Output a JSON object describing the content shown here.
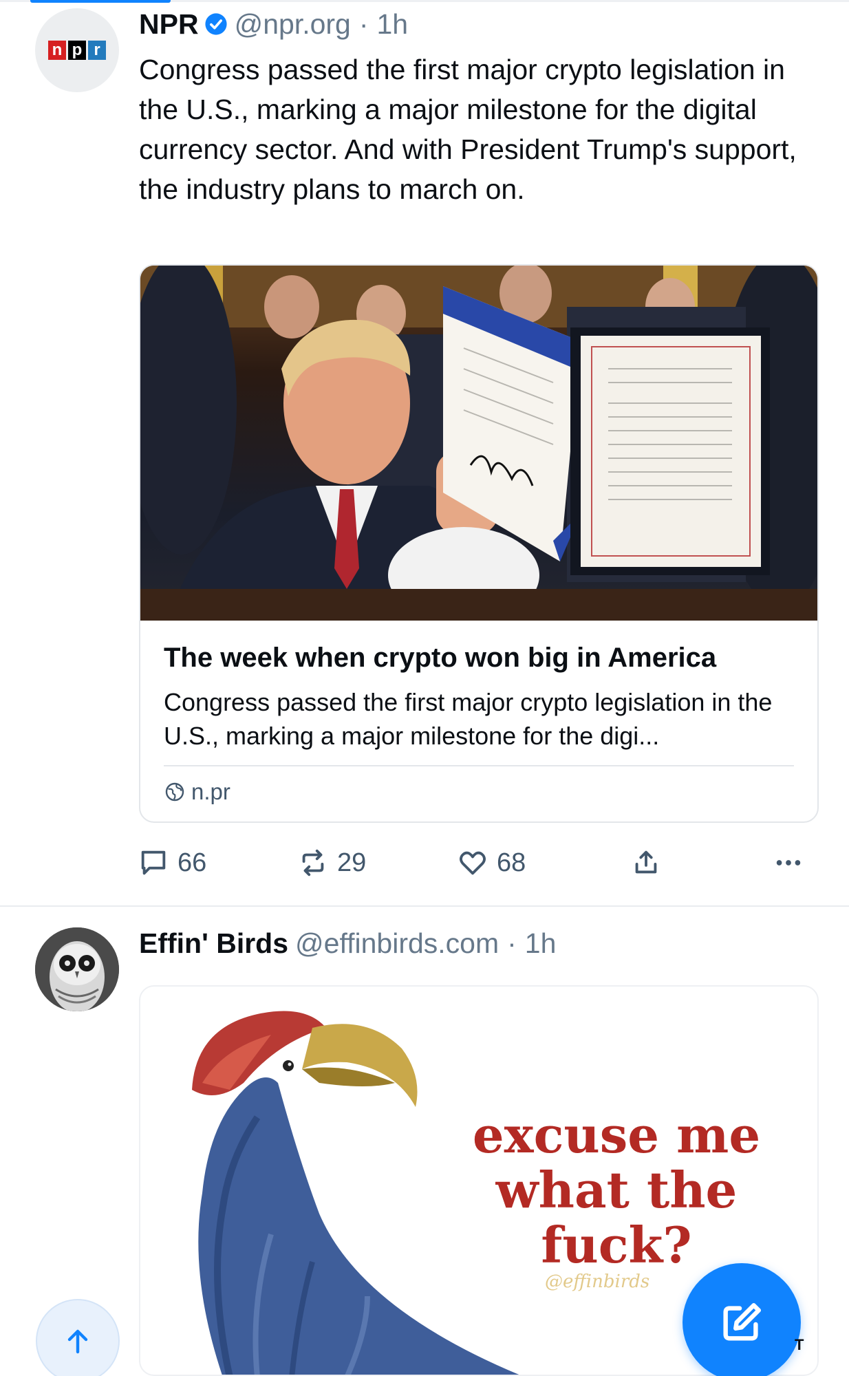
{
  "feed": {
    "posts": [
      {
        "author": {
          "name": "NPR",
          "handle": "@npr.org",
          "time": "1h",
          "verified": true,
          "avatar_logo": [
            "n",
            "p",
            "r"
          ]
        },
        "text": "Congress passed the first major crypto legislation in the U.S., marking a major milestone for the digital currency sector. And with President Trump's support, the industry plans to march on.",
        "embed": {
          "title": "The week when crypto won big in America",
          "description": "Congress passed the first major crypto legislation in the U.S., marking a major milestone for the digi...",
          "domain": "n.pr"
        },
        "stats": {
          "replies": "66",
          "reposts": "29",
          "likes": "68"
        }
      },
      {
        "author": {
          "name": "Effin' Birds",
          "handle": "@effinbirds.com",
          "time": "1h"
        },
        "image_text": [
          "excuse me",
          "what the",
          "fuck?"
        ],
        "watermark": "@effinbirds"
      }
    ]
  },
  "separator": "·",
  "fab_peek_text": "T",
  "colors": {
    "accent": "#1083fe",
    "muted": "#66788a",
    "border": "#e3e6ea",
    "bird_text": "#b32a24"
  },
  "icons": {
    "verified": "verified-check-icon",
    "reply": "speech-bubble-icon",
    "repost": "repost-arrows-icon",
    "like": "heart-icon",
    "share": "share-upload-icon",
    "more": "ellipsis-icon",
    "domain": "globe-icon",
    "scroll_top": "arrow-up-icon",
    "compose": "pencil-edit-icon"
  }
}
